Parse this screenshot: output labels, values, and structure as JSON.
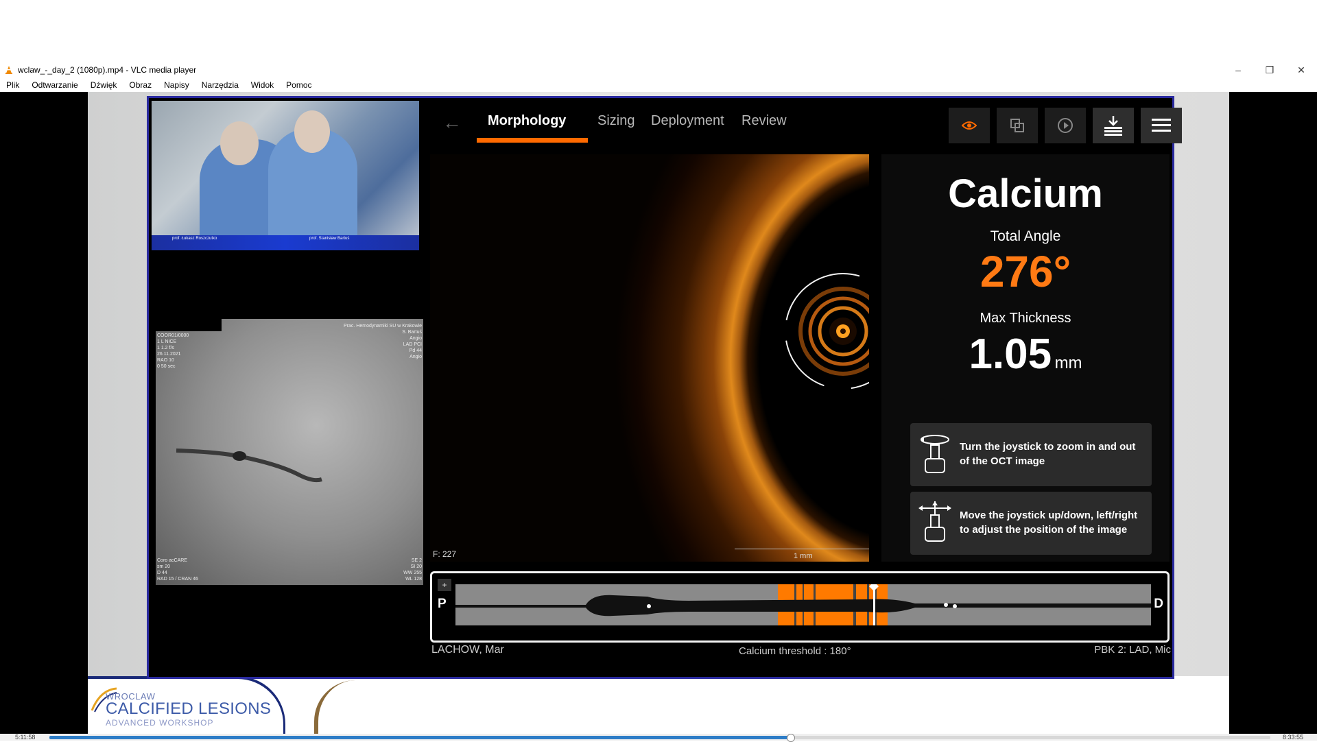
{
  "window": {
    "title": "wclaw_-_day_2 (1080p).mp4 - VLC media player",
    "controls": {
      "minimize": "–",
      "restore": "❐",
      "close": "✕"
    }
  },
  "menu": [
    "Plik",
    "Odtwarzanie",
    "Dźwięk",
    "Obraz",
    "Napisy",
    "Narzędzia",
    "Widok",
    "Pomoc"
  ],
  "video": {
    "camera": {
      "names": [
        "prof. Łukasz Roszczutko",
        "prof. Stanisław Bartuś"
      ]
    },
    "angio": {
      "text_left": "COOR01/0000\n1 L NICE\n1 1.2 f/s\n26.11.2021\nRAO 10\n0 50 sec",
      "text_right": "Prac. Hemodynamiki SU w Krakowie\nS. Bartuś\nAngio\nLAD PCI\nPd 44\nAngio",
      "text_bottom": "Coro acCARE\nsm 20\nD 44\nRAD 15 / CRAN 46",
      "text_br": "SE 2\nSI 20\nWW 255\nWL 128"
    },
    "oct": {
      "tabs": {
        "morphology": "Morphology",
        "sizing": "Sizing",
        "deployment": "Deployment",
        "review": "Review"
      },
      "back": "←",
      "frame_number": "F: 227",
      "scale_label": "1 mm",
      "calcium": {
        "title": "Calcium",
        "total_angle_label": "Total Angle",
        "total_angle_value": "276°",
        "max_thickness_label": "Max Thickness",
        "max_thickness_value": "1.05",
        "max_thickness_unit": "mm"
      },
      "hints": {
        "zoom": "Turn the joystick to zoom in and out of the OCT image",
        "move": "Move the joystick up/down, left/right to adjust the position of the image"
      },
      "lview": {
        "plus": "+",
        "proximal": "P",
        "distal": "D"
      },
      "patient": "LACHOW,  Mar",
      "calcium_threshold": "Calcium threshold :  180°",
      "pbk": "PBK 2:  LAD,  Mic"
    },
    "banner": {
      "wroclaw": "WROCLAW",
      "title": "CALCIFIED LESIONS",
      "subtitle": "ADVANCED WORKSHOP"
    }
  },
  "player": {
    "elapsed": "5:11:58",
    "total": "8:33:55",
    "progress": 0.607
  },
  "colors": {
    "accent": "#ff6a00",
    "vlc_blue": "#2e7dc7",
    "monitor_border": "#2a2aa0"
  }
}
